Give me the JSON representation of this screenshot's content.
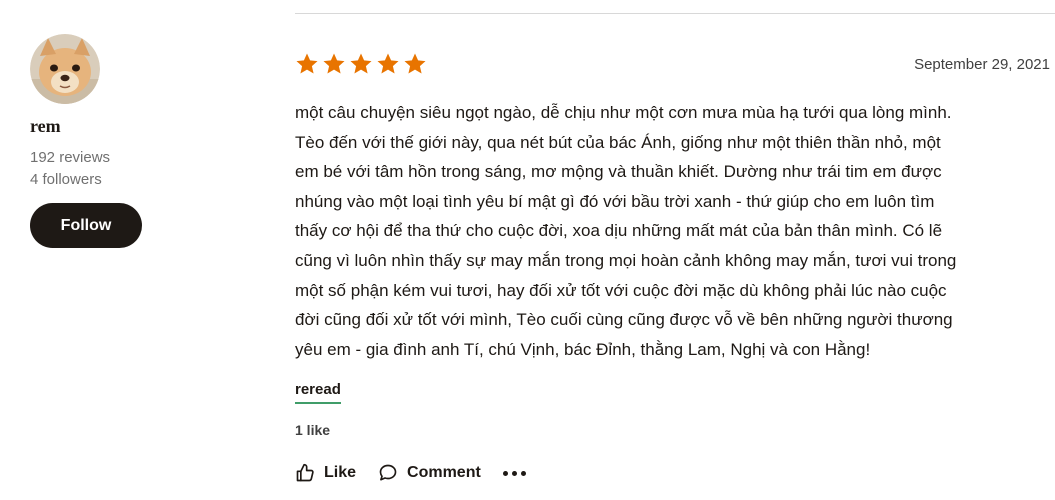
{
  "reviewer": {
    "name": "rem",
    "reviews": "192 reviews",
    "followers": "4 followers",
    "follow_label": "Follow"
  },
  "review": {
    "rating": 5,
    "rating_max": 5,
    "date": "September 29, 2021",
    "lines": [
      "một câu chuyện siêu ngọt ngào, dễ chịu như một cơn mưa mùa hạ tưới qua lòng mình.",
      "Tèo đến với thế giới này, qua nét bút của bác Ánh, giống như một thiên thần nhỏ, một",
      "em bé với tâm hồn trong sáng, mơ mộng và thuần khiết. Dường như trái tim em được",
      "nhúng vào một loại tình yêu bí mật gì đó với bầu trời xanh - thứ giúp cho em luôn tìm",
      "thấy cơ hội để tha thứ cho cuộc đời, xoa dịu những mất mát của bản thân mình. Có lẽ",
      "cũng vì luôn nhìn thấy sự may mắn trong mọi hoàn cảnh không may mắn, tươi vui trong",
      "một số phận kém vui tươi, hay đối xử tốt với cuộc đời mặc dù không phải lúc nào cuộc",
      "đời cũng đối xử tốt với mình, Tèo cuối cùng cũng được vỗ về bên những người thương",
      "yêu em - gia đình anh Tí, chú Vịnh, bác Đỉnh, thằng Lam, Nghị và con Hằng!"
    ],
    "shelf": "reread",
    "likes_count": "1 like"
  },
  "actions": {
    "like_label": "Like",
    "comment_label": "Comment"
  },
  "colors": {
    "star": "#e87400",
    "follow_bg": "#1e1915",
    "shelf_underline": "#409d69"
  },
  "icons": [
    "thumbs-up-icon",
    "comment-icon",
    "more-options-icon",
    "star-icon"
  ]
}
